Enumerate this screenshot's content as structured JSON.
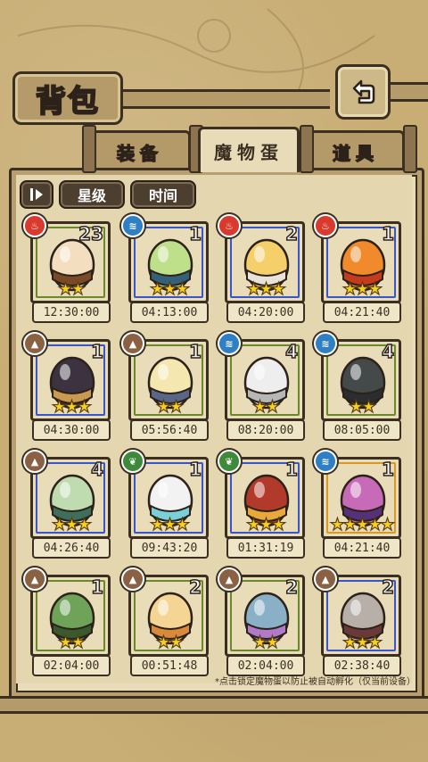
{
  "header": {
    "title": "背包"
  },
  "tabs": [
    {
      "label": "装备",
      "active": false
    },
    {
      "label": "魔物蛋",
      "active": true
    },
    {
      "label": "道具",
      "active": false
    }
  ],
  "sort": {
    "icon": "sort-icon",
    "star_label": "星级",
    "time_label": "时间"
  },
  "colors": {
    "fire": "#d93a2e",
    "water": "#2f7fc4",
    "earth": "#8a6243",
    "wood": "#3f8a3a",
    "frame_blue": "#3a55c9",
    "frame_green": "#6a8a2a",
    "frame_gold": "#d99a20",
    "star": "#f7d11e"
  },
  "cards": [
    {
      "element": "fire",
      "count": "23",
      "stars": "★★",
      "time": "12:30:00",
      "egg": "caramel-egg",
      "frame": "green"
    },
    {
      "element": "water",
      "count": "1",
      "stars": "★★★",
      "time": "04:13:00",
      "egg": "striped-egg",
      "frame": "blue"
    },
    {
      "element": "fire",
      "count": "2",
      "stars": "★★★",
      "time": "04:20:00",
      "egg": "sun-egg",
      "frame": "blue"
    },
    {
      "element": "fire",
      "count": "1",
      "stars": "★★★",
      "time": "04:21:40",
      "egg": "flame-egg",
      "frame": "blue"
    },
    {
      "element": "earth",
      "count": "1",
      "stars": "★★★",
      "time": "04:30:00",
      "egg": "bat-egg",
      "frame": "blue"
    },
    {
      "element": "earth",
      "count": "1",
      "stars": "★★",
      "time": "05:56:40",
      "egg": "armored-egg",
      "frame": "green"
    },
    {
      "element": "water",
      "count": "4",
      "stars": "★★",
      "time": "08:20:00",
      "egg": "ghost-egg",
      "frame": "green"
    },
    {
      "element": "water",
      "count": "4",
      "stars": "★★",
      "time": "08:05:00",
      "egg": "turtle-egg",
      "frame": "green"
    },
    {
      "element": "earth",
      "count": "4",
      "stars": "★★★",
      "time": "04:26:40",
      "egg": "cloaked-egg",
      "frame": "blue"
    },
    {
      "element": "wood",
      "count": "1",
      "stars": "★★★",
      "time": "09:43:20",
      "egg": "gem-egg",
      "frame": "blue"
    },
    {
      "element": "wood",
      "count": "1",
      "stars": "★★★",
      "time": "01:31:19",
      "egg": "strawberry-egg",
      "frame": "blue"
    },
    {
      "element": "water",
      "count": "1",
      "stars": "★★★★★",
      "time": "04:21:40",
      "egg": "tentacle-egg",
      "frame": "gold"
    },
    {
      "element": "earth",
      "count": "1",
      "stars": "★★",
      "time": "02:04:00",
      "egg": "sprout-egg",
      "frame": "green"
    },
    {
      "element": "earth",
      "count": "2",
      "stars": "★★",
      "time": "00:51:48",
      "egg": "bandaged-egg",
      "frame": "green"
    },
    {
      "element": "earth",
      "count": "2",
      "stars": "★★",
      "time": "02:04:00",
      "egg": "leaf-egg",
      "frame": "green"
    },
    {
      "element": "earth",
      "count": "2",
      "stars": "★★★",
      "time": "02:38:40",
      "egg": "book-egg",
      "frame": "blue"
    }
  ],
  "footnote": "*点击锁定魔物蛋以防止被自动孵化（仅当前设备）"
}
